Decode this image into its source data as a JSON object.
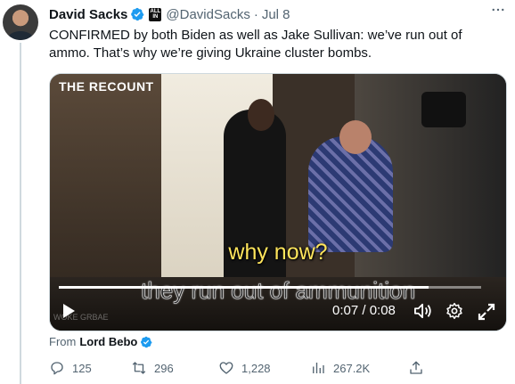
{
  "tweet": {
    "display_name": "David Sacks",
    "affiliate_badge": "ALL IN",
    "handle": "@DavidSacks",
    "separator": "·",
    "date": "Jul 8",
    "more_icon": "more-horizontal-icon",
    "text": "CONFIRMED by both Biden as well as Jake Sullivan: we’ve run out of ammo. That’s why we’re giving Ukraine cluster bombs."
  },
  "video": {
    "channel_logo": "THE RECOUNT",
    "caption_top": "why now?",
    "caption_bottom": "they run out of ammunition",
    "watermark": "WOKE GRBAE",
    "current_time": "0:07",
    "duration": "0:08",
    "time_display": "0:07 / 0:08",
    "progress_fraction": 0.875,
    "icons": [
      "play-icon",
      "volume-icon",
      "settings-icon",
      "fullscreen-icon"
    ]
  },
  "source": {
    "from_label": "From",
    "from_name": "Lord Bebo"
  },
  "actions": {
    "replies": "125",
    "reposts": "296",
    "likes": "1,228",
    "views": "267.2K"
  },
  "colors": {
    "verified_blue": "#1d9bf0",
    "secondary_text": "#536471",
    "primary_text": "#0f1419",
    "caption_yellow": "#ffe55c"
  }
}
